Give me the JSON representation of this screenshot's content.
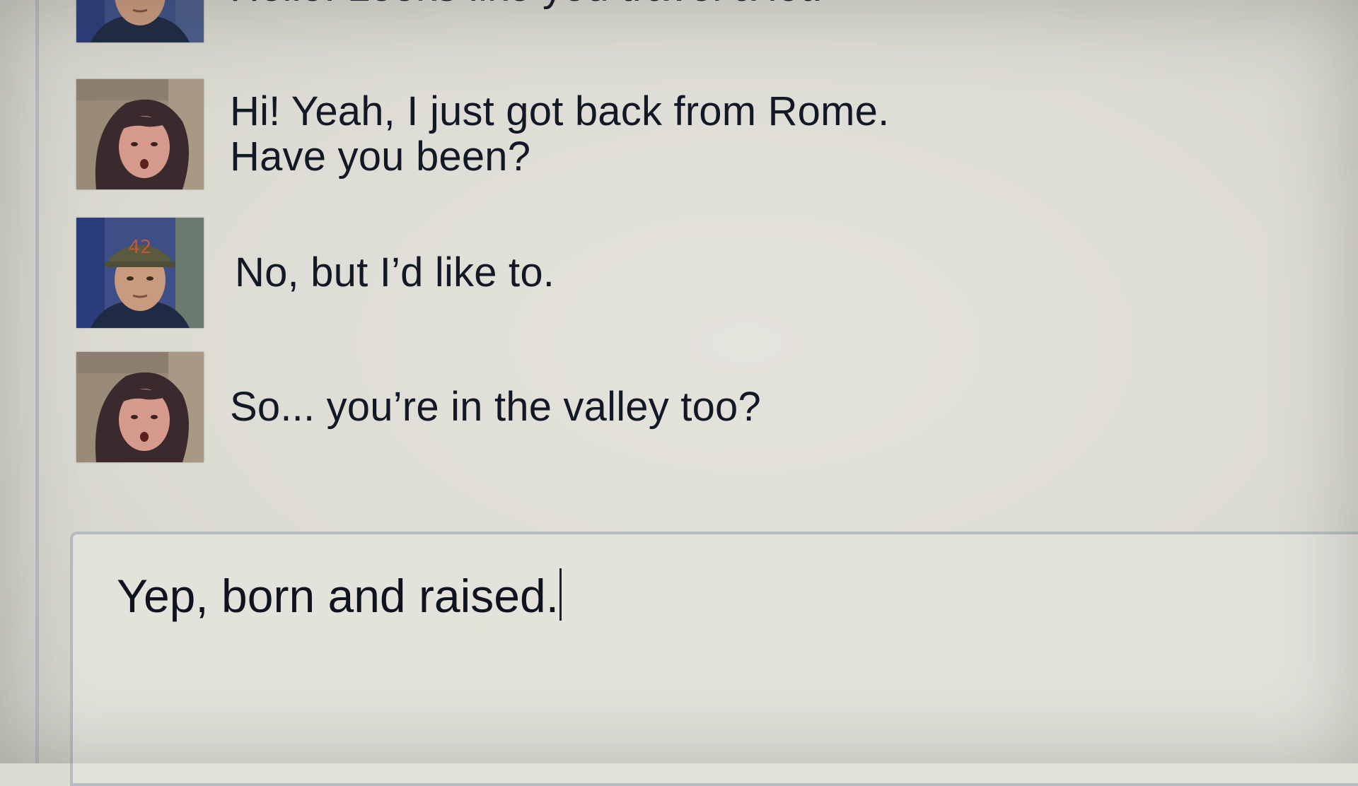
{
  "chat": {
    "messages": [
      {
        "sender": "man",
        "lines": [
          "Hello! Looks like you travel a lot."
        ]
      },
      {
        "sender": "woman",
        "lines": [
          "Hi! Yeah, I just got back from Rome.",
          "Have you been?"
        ]
      },
      {
        "sender": "man",
        "lines": [
          "No, but I’d like to."
        ]
      },
      {
        "sender": "woman",
        "lines": [
          "So... you’re in the valley too?"
        ]
      }
    ]
  },
  "composer": {
    "value": "Yep, born and raised."
  },
  "colors": {
    "background": "#dcdcd4",
    "text": "#131827",
    "border": "#b5bcc4"
  }
}
